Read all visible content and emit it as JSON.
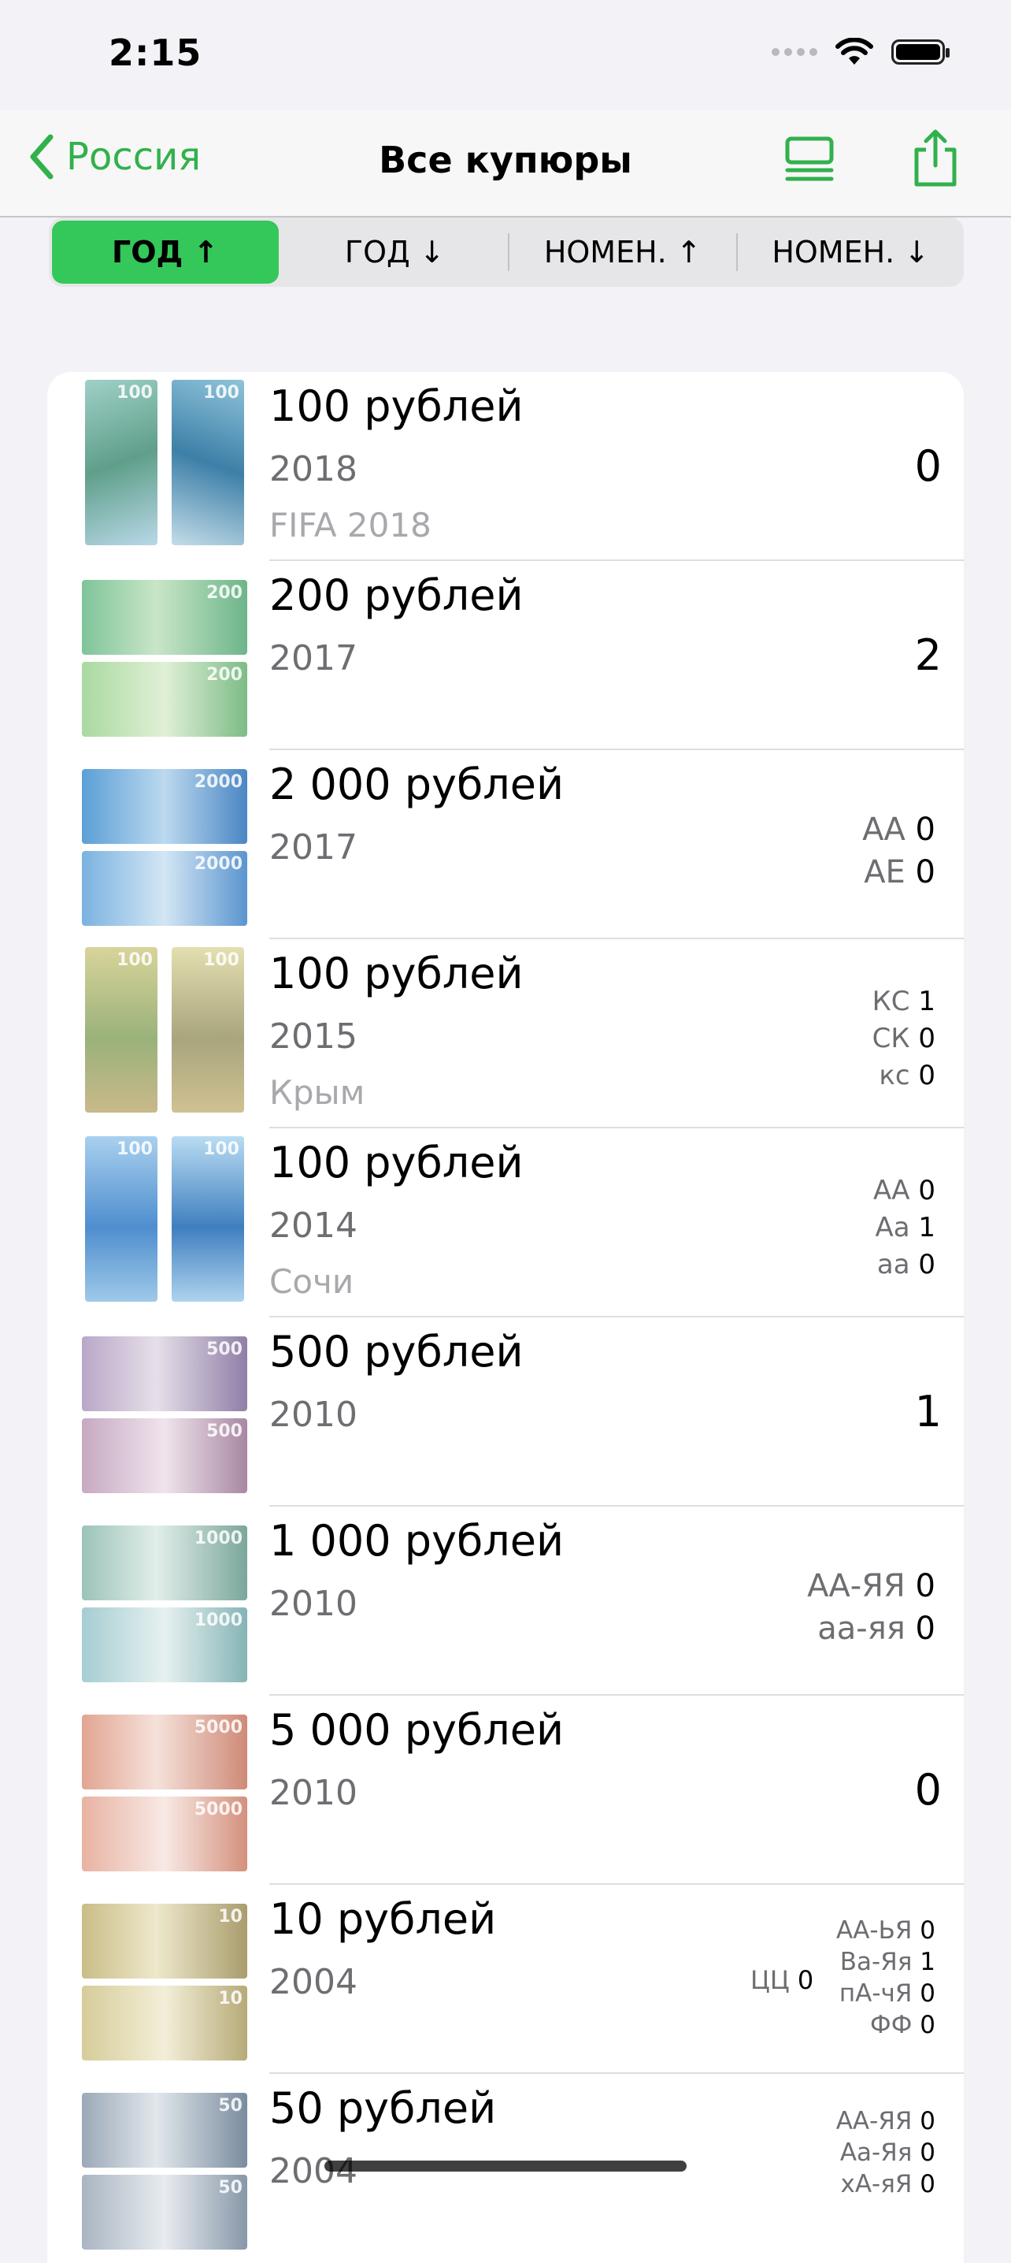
{
  "status": {
    "time": "2:15"
  },
  "nav": {
    "back_label": "Россия",
    "title": "Все купюры"
  },
  "colors": {
    "accent": "#34c759",
    "back": "#31b14c"
  },
  "segments": [
    "ГОД ↑",
    "ГОД ↓",
    "НОМЕН. ↑",
    "НОМЕН. ↓"
  ],
  "selected_segment": "ГОД ↑",
  "items": [
    {
      "title": "100 рублей",
      "year": "2018",
      "subtitle": "FIFA 2018",
      "count": "0",
      "series": []
    },
    {
      "title": "200 рублей",
      "year": "2017",
      "subtitle": "",
      "count": "2",
      "series": []
    },
    {
      "title": "2 000 рублей",
      "year": "2017",
      "subtitle": "",
      "series": [
        {
          "code": "АА",
          "count": "0"
        },
        {
          "code": "АЕ",
          "count": "0"
        }
      ]
    },
    {
      "title": "100 рублей",
      "year": "2015",
      "subtitle": "Крым",
      "series": [
        {
          "code": "КС",
          "count": "1"
        },
        {
          "code": "СК",
          "count": "0"
        },
        {
          "code": "кс",
          "count": "0"
        }
      ]
    },
    {
      "title": "100 рублей",
      "year": "2014",
      "subtitle": "Сочи",
      "series": [
        {
          "code": "АА",
          "count": "0"
        },
        {
          "code": "Аа",
          "count": "1"
        },
        {
          "code": "аа",
          "count": "0"
        }
      ]
    },
    {
      "title": "500 рублей",
      "year": "2010",
      "subtitle": "",
      "count": "1",
      "series": []
    },
    {
      "title": "1 000 рублей",
      "year": "2010",
      "subtitle": "",
      "series": [
        {
          "code": "АА-ЯЯ",
          "count": "0"
        },
        {
          "code": "аа-яя",
          "count": "0"
        }
      ]
    },
    {
      "title": "5 000 рублей",
      "year": "2010",
      "subtitle": "",
      "count": "0",
      "series": []
    },
    {
      "title": "10 рублей",
      "year": "2004",
      "subtitle": "",
      "extra": {
        "code": "ЦЦ",
        "count": "0"
      },
      "series": [
        {
          "code": "АА-ЬЯ",
          "count": "0"
        },
        {
          "code": "Ва-Яя",
          "count": "1"
        },
        {
          "code": "пА-чЯ",
          "count": "0"
        },
        {
          "code": "ФФ",
          "count": "0"
        }
      ]
    },
    {
      "title": "50 рублей",
      "year": "2004",
      "subtitle": "",
      "series": [
        {
          "code": "АА-ЯЯ",
          "count": "0"
        },
        {
          "code": "Аа-Яя",
          "count": "0"
        },
        {
          "code": "хА-яЯ",
          "count": "0"
        }
      ]
    }
  ]
}
